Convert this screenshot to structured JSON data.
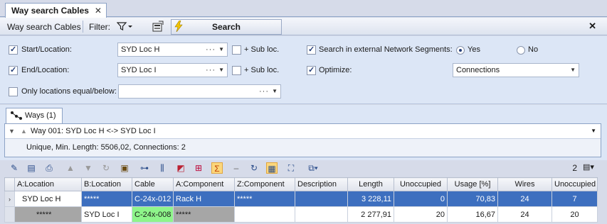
{
  "tab": {
    "title": "Way search Cables",
    "close": "✕"
  },
  "toolbar": {
    "label": "Way search Cables",
    "filter_label": "Filter:",
    "filter_icon": "funnel-icon",
    "search_label": "Search",
    "close": "✕"
  },
  "form": {
    "start": {
      "label": "Start/Location:",
      "checked": true,
      "value": "SYD Loc H",
      "sub_label": "+ Sub loc.",
      "sub_checked": false
    },
    "end": {
      "label": "End/Location:",
      "checked": true,
      "value": "SYD Loc I",
      "sub_label": "+ Sub loc.",
      "sub_checked": false
    },
    "only_equal": {
      "label": "Only locations equal/below:",
      "checked": false,
      "value": ""
    },
    "external": {
      "label": "Search in external Network Segments:",
      "checked": true,
      "yes": "Yes",
      "no": "No",
      "selected": "Yes"
    },
    "optimize": {
      "label": "Optimize:",
      "checked": true,
      "value": "Connections"
    },
    "dots": "···"
  },
  "ways": {
    "tab_label": "Ways (1)",
    "way_title": "Way 001: SYD Loc H <-> SYD Loc I",
    "info": "Unique, Min. Length: 5506,02, Connections: 2"
  },
  "grid_toolbar": {
    "count": "2"
  },
  "grid": {
    "columns": [
      "A:Location",
      "B:Location",
      "Cable",
      "A:Component",
      "Z:Component",
      "Description",
      "Length",
      "Unoccupied",
      "Usage [%]",
      "Wires",
      "Unoccupied"
    ],
    "rows": [
      [
        "SYD Loc H",
        "*****",
        "C-24x-012",
        "Rack H",
        "*****",
        "",
        "3 228,11",
        "0",
        "70,83",
        "24",
        "7"
      ],
      [
        "*****",
        "SYD Loc I",
        "C-24x-008",
        "*****",
        "",
        "",
        "2 277,91",
        "20",
        "16,67",
        "24",
        "20"
      ]
    ]
  },
  "colors": {
    "selection": "#3d6fbf",
    "green_cell": "#8ef58a",
    "gray_cell": "#a6a6a6",
    "form_bg": "#dce6f6"
  }
}
